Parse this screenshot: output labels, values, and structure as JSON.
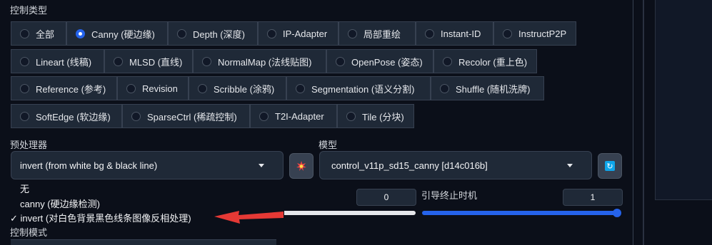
{
  "control_type": {
    "label": "控制类型",
    "options": [
      "全部",
      "Canny (硬边缘)",
      "Depth (深度)",
      "IP-Adapter",
      "局部重绘",
      "Instant-ID",
      "InstructP2P",
      "Lineart (线稿)",
      "MLSD (直线)",
      "NormalMap (法线贴图)",
      "OpenPose (姿态)",
      "Recolor (重上色)",
      "Reference (参考)",
      "Revision",
      "Scribble (涂鸦)",
      "Segmentation (语义分割)",
      "Shuffle (随机洗牌)",
      "SoftEdge (软边缘)",
      "SparseCtrl (稀疏控制)",
      "T2I-Adapter",
      "Tile (分块)"
    ],
    "selected": "Canny (硬边缘)"
  },
  "preprocessor": {
    "label": "预处理器",
    "value": "invert (from white bg & black line)",
    "menu": [
      "无",
      "canny (硬边缘检测)",
      "✓ invert (对白色背景黑色线条图像反相处理)"
    ]
  },
  "model": {
    "label": "模型",
    "value": "control_v11p_sd15_canny [d14c016b]"
  },
  "guidance_start": {
    "value": "0"
  },
  "guidance_end": {
    "label": "引导终止时机",
    "value": "1"
  },
  "control_mode": {
    "label": "控制模式"
  },
  "colors": {
    "accent": "#2563eb",
    "arrow": "#e53935",
    "panel": "#1f2937",
    "background": "#0b0f19"
  }
}
